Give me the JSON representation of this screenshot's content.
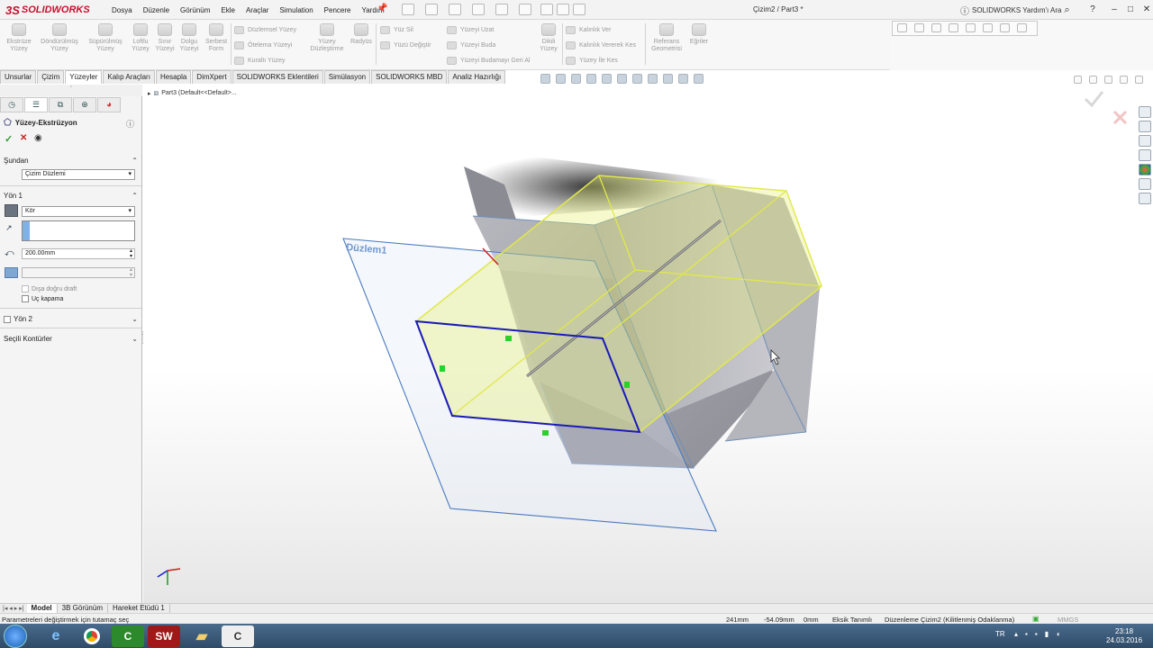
{
  "app": {
    "brand": "SOLIDWORKS",
    "title": "Çizim2 / Part3 *",
    "menu": [
      "Dosya",
      "Düzenle",
      "Görünüm",
      "Ekle",
      "Araçlar",
      "Simulation",
      "Pencere",
      "Yardım"
    ],
    "help_search": "SOLIDWORKS Yardım'ı Ara",
    "win_controls": [
      "?",
      "–",
      "□",
      "✕"
    ]
  },
  "cmd": {
    "big_tools": [
      {
        "label1": "Ekstrüze",
        "label2": "Yüzey"
      },
      {
        "label1": "Döndürülmüş",
        "label2": "Yüzey"
      },
      {
        "label1": "Süpürülmüş",
        "label2": "Yüzey"
      },
      {
        "label1": "Loftlu",
        "label2": "Yüzey"
      },
      {
        "label1": "Sınır",
        "label2": "Yüzeyi"
      },
      {
        "label1": "Dolgu",
        "label2": "Yüzeyi"
      },
      {
        "label1": "Serbest",
        "label2": "Form"
      }
    ],
    "col1": [
      "Düzlemsel Yüzey",
      "Ötelema Yüzeyi",
      "Kuraltı Yüzey"
    ],
    "mid_tools": [
      {
        "label1": "Yüzey",
        "label2": "Düzleştirme"
      },
      {
        "label1": "Radyüs",
        "label2": ""
      }
    ],
    "col2": [
      "Yüz Sil",
      "Yüzü Değiştir"
    ],
    "col3": [
      "Yüzeyi Uzat",
      "Yüzeyi Buda",
      "Yüzeyi Budamayı Geri Al"
    ],
    "dikil": {
      "label1": "Dikili",
      "label2": "Yüzey"
    },
    "col4": [
      "Kalınlık Ver",
      "Kalınlık Vererek Kes",
      "Yüzey İle Kes"
    ],
    "ref": {
      "label1": "Referans",
      "label2": "Geometrisi"
    },
    "egriler": {
      "label1": "Eğriler",
      "label2": ""
    }
  },
  "tabs": [
    "Unsurlar",
    "Çizim",
    "Yüzeyler",
    "Kalıp Araçları",
    "Hesapla",
    "DimXpert",
    "SOLIDWORKS Eklentileri",
    "Simülasyon",
    "SOLIDWORKS MBD",
    "Analiz Hazırlığı"
  ],
  "active_tab": "Yüzeyler",
  "feature": {
    "name": "Yüzey-Ekstrüzyon",
    "sundan": {
      "header": "Şundan",
      "value": "Çizim Düzlemi"
    },
    "yon1": {
      "header": "Yön 1",
      "end_condition": "Kör",
      "depth": "200.00mm",
      "options": [
        {
          "label": "Dışa doğru draft",
          "checked": false
        },
        {
          "label": "Uç kapama",
          "checked": false
        }
      ]
    },
    "yon2": {
      "header": "Yön 2"
    },
    "secili": {
      "header": "Seçili Kontürler"
    }
  },
  "breadcrumb": "Part3  (Default<<Default>...",
  "plane_label": "Düzlem1",
  "model_tabs": [
    "Model",
    "3B Görünüm",
    "Hareket Etüdü 1"
  ],
  "active_model_tab": "Model",
  "status": {
    "hint": "Parametreleri değiştirmek için tutamaç seç",
    "x": "241mm",
    "y": "-54.09mm",
    "z": "0mm",
    "defined": "Eksik Tanımlı",
    "editing": "Düzenleme Çizim2 (Kilitlenmiş Odaklanma)",
    "units": "MMGS"
  },
  "taskbar": {
    "lang": "TR",
    "time": "23:18",
    "date": "24.03.2016"
  },
  "colors": {
    "plane_blue": "#4a7bbf",
    "sketch_blue": "#1a1ab8",
    "preview_yellow": "#e8f070",
    "body_gray": "#9a9aa2",
    "accent_red": "#c8102e"
  }
}
